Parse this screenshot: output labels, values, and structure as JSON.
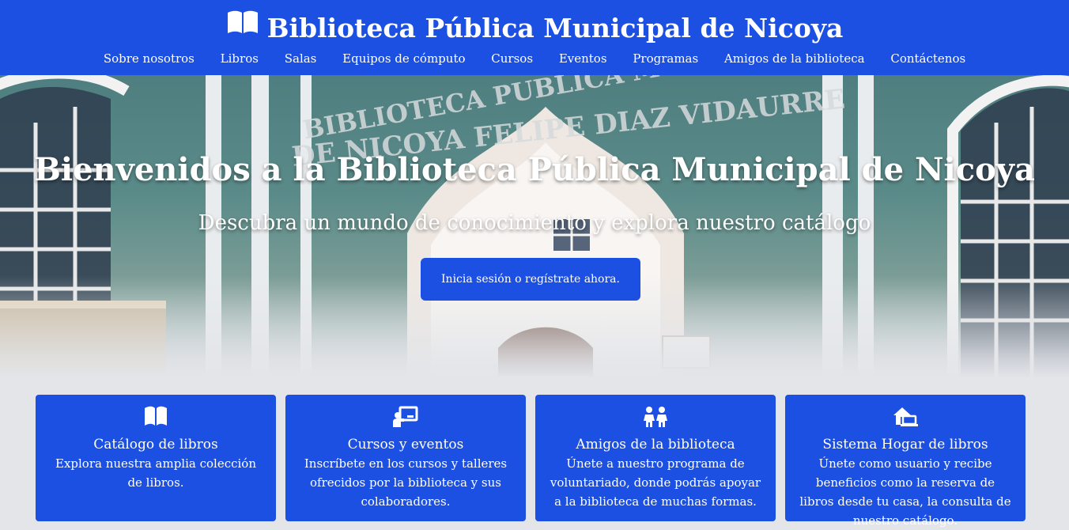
{
  "header": {
    "logo_icon": "open-book-icon",
    "title": "Biblioteca Pública Municipal de Nicoya",
    "background": "#1c50e2",
    "nav": [
      {
        "label": "Sobre nosotros"
      },
      {
        "label": "Libros"
      },
      {
        "label": "Salas"
      },
      {
        "label": "Equipos de cómputo"
      },
      {
        "label": "Cursos"
      },
      {
        "label": "Eventos"
      },
      {
        "label": "Programas"
      },
      {
        "label": "Amigos de la biblioteca"
      },
      {
        "label": "Contáctenos"
      }
    ]
  },
  "hero": {
    "title": "Bienvenidos a la Biblioteca Pública Municipal de Nicoya",
    "subtitle": "Descubra un mundo de conocimiento y explora nuestro catálogo",
    "cta_label": "Inicia sesión o regístrate ahora.",
    "sign_line1": "BIBLIOTECA PUBLICA MUNICIPAL",
    "sign_line2": "DE NICOYA FELIPE DIAZ VIDAURRE"
  },
  "cards": [
    {
      "icon": "book-icon",
      "title": "Catálogo de libros",
      "text": "Explora nuestra amplia colección de libros."
    },
    {
      "icon": "chalkboard-teacher-icon",
      "title": "Cursos y eventos",
      "text": "Inscríbete en los cursos y talleres ofrecidos por la biblioteca y sus colaboradores."
    },
    {
      "icon": "children-icon",
      "title": "Amigos de la biblioteca",
      "text": "Únete a nuestro programa de voluntariado, donde podrás apoyar a la biblioteca de muchas formas."
    },
    {
      "icon": "house-laptop-icon",
      "title": "Sistema Hogar de libros",
      "text": "Únete como usuario y recibe beneficios como la reserva de libros desde tu casa, la consulta de nuestro catálogo."
    }
  ]
}
